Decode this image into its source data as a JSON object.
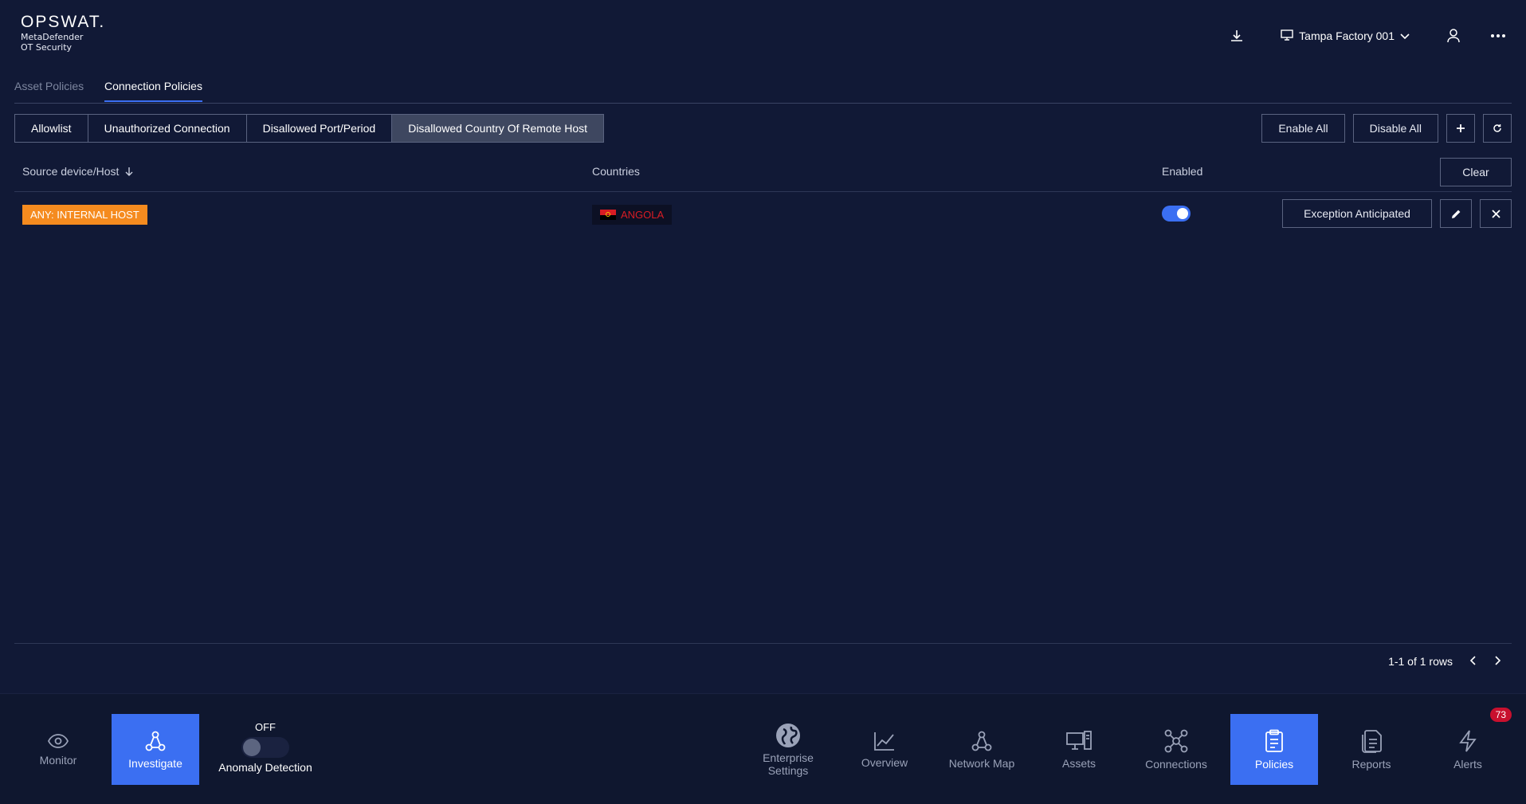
{
  "header": {
    "brand": "OPSWAT.",
    "product_line1": "MetaDefender",
    "product_line2": "OT Security",
    "site_name": "Tampa Factory 001"
  },
  "policy_tabs": [
    {
      "label": "Asset Policies",
      "active": false
    },
    {
      "label": "Connection Policies",
      "active": true
    }
  ],
  "filters": [
    {
      "label": "Allowlist",
      "active": false
    },
    {
      "label": "Unauthorized Connection",
      "active": false
    },
    {
      "label": "Disallowed Port/Period",
      "active": false
    },
    {
      "label": "Disallowed Country Of Remote Host",
      "active": true
    }
  ],
  "actions": {
    "enable_all": "Enable All",
    "disable_all": "Disable All",
    "add_icon": "plus-icon",
    "refresh_icon": "refresh-icon"
  },
  "table": {
    "columns": {
      "source": "Source device/Host",
      "countries": "Countries",
      "enabled": "Enabled"
    },
    "clear_label": "Clear",
    "rows": [
      {
        "source": "ANY: INTERNAL HOST",
        "country": "ANGOLA",
        "enabled": true,
        "exception_label": "Exception Anticipated"
      }
    ]
  },
  "pager": {
    "summary": "1-1 of 1 rows"
  },
  "bottom_nav": {
    "monitor": "Monitor",
    "investigate": "Investigate",
    "anomaly_state": "OFF",
    "anomaly_label": "Anomaly Detection",
    "enterprise_line1": "Enterprise",
    "enterprise_line2": "Settings",
    "overview": "Overview",
    "network_map": "Network Map",
    "assets": "Assets",
    "connections": "Connections",
    "policies": "Policies",
    "reports": "Reports",
    "alerts": "Alerts",
    "alerts_count": "73"
  },
  "colors": {
    "background": "#111936",
    "accent": "#3b6ff2",
    "host_tag": "#f58b1f",
    "country_text": "#d81c24",
    "badge": "#c8102e"
  }
}
